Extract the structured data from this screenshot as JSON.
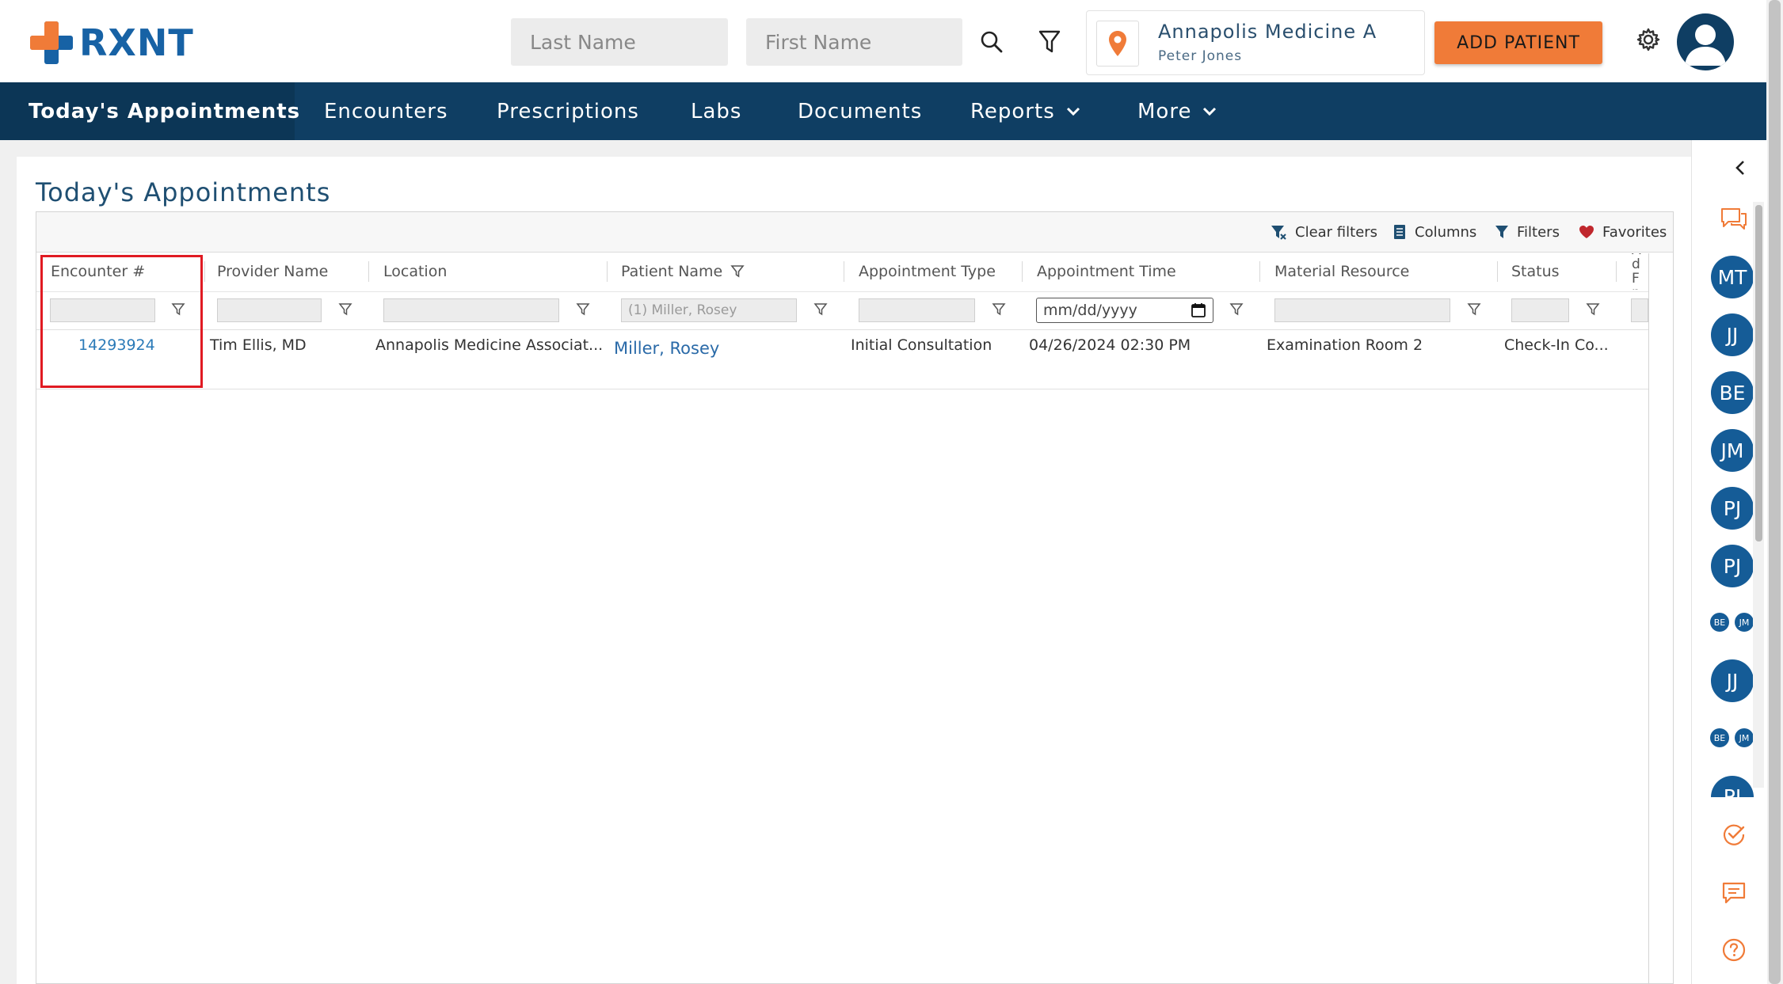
{
  "header": {
    "logo_text": "RXNT",
    "last_name_placeholder": "Last Name",
    "first_name_placeholder": "First Name",
    "location_name": "Annapolis Medicine A",
    "location_user": "Peter Jones",
    "add_patient_label": "ADD PATIENT",
    "colors": {
      "brand_blue": "#1762a5",
      "brand_orange": "#f07b38"
    }
  },
  "nav": {
    "items": [
      {
        "label": "Today's Appointments"
      },
      {
        "label": "Encounters"
      },
      {
        "label": "Prescriptions"
      },
      {
        "label": "Labs"
      },
      {
        "label": "Documents"
      },
      {
        "label": "Reports"
      },
      {
        "label": "More"
      }
    ]
  },
  "page": {
    "title": "Today's Appointments"
  },
  "toolbar": {
    "clear_filters": "Clear filters",
    "columns": "Columns",
    "filters": "Filters",
    "favorites": "Favorites"
  },
  "table": {
    "columns": [
      "Encounter #",
      "Provider Name",
      "Location",
      "Patient Name",
      "Appointment Type",
      "Appointment Time",
      "Material Resource",
      "Status",
      "Ad Fn"
    ],
    "filters": {
      "patient_name": "(1) Miller, Rosey",
      "appointment_time_placeholder": "mm/dd/yyyy"
    },
    "rows": [
      {
        "encounter": "14293924",
        "provider": "Tim Ellis, MD",
        "location": "Annapolis Medicine Associat...",
        "patient": "Miller, Rosey",
        "appointment_type": "Initial Consultation",
        "appointment_time": "04/26/2024 02:30 PM",
        "material_resource": "Examination Room 2",
        "status": "Check-In Co..."
      }
    ]
  },
  "sidebar": {
    "avatars": [
      "MT",
      "JJ",
      "BE",
      "JM",
      "PJ",
      "PJ",
      "JJ"
    ],
    "small_pair_1": [
      "BE",
      "JM"
    ],
    "small_pair_2": [
      "BE",
      "JM"
    ],
    "partial_avatar": "PJ"
  }
}
